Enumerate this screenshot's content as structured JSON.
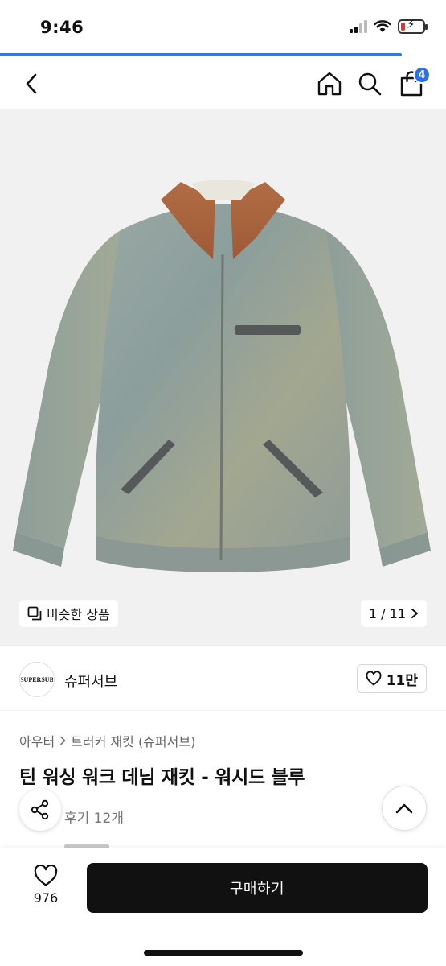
{
  "status_bar": {
    "time": "9:46",
    "battery_level": 0.2,
    "battery_color": "#e5332a",
    "icons": [
      "cellular-signal-icon",
      "wifi-icon",
      "battery-charging-icon"
    ]
  },
  "page_progress": 0.9,
  "colors": {
    "accent": "#2d7be8",
    "badge": "#2d6fe8",
    "buy_button": "#111111"
  },
  "nav": {
    "back_icon": "chevron-left-icon",
    "home_icon": "home-icon",
    "search_icon": "search-icon",
    "cart_icon": "shopping-bag-icon",
    "cart_count": "4"
  },
  "gallery": {
    "similar_label": "비슷한 상품",
    "counter": "1 / 11"
  },
  "brand": {
    "logo_text": "SUPERSUB",
    "name": "슈퍼서브",
    "likes": "11만"
  },
  "product": {
    "breadcrumb": [
      "아우터",
      "트러커 재킷 (슈퍼서브)"
    ],
    "title": "틴 워싱 워크 데님 재킷 - 워시드 블루",
    "review_link": "후기 12개"
  },
  "bottom_bar": {
    "wish_count": "976",
    "buy_label": "구매하기"
  }
}
